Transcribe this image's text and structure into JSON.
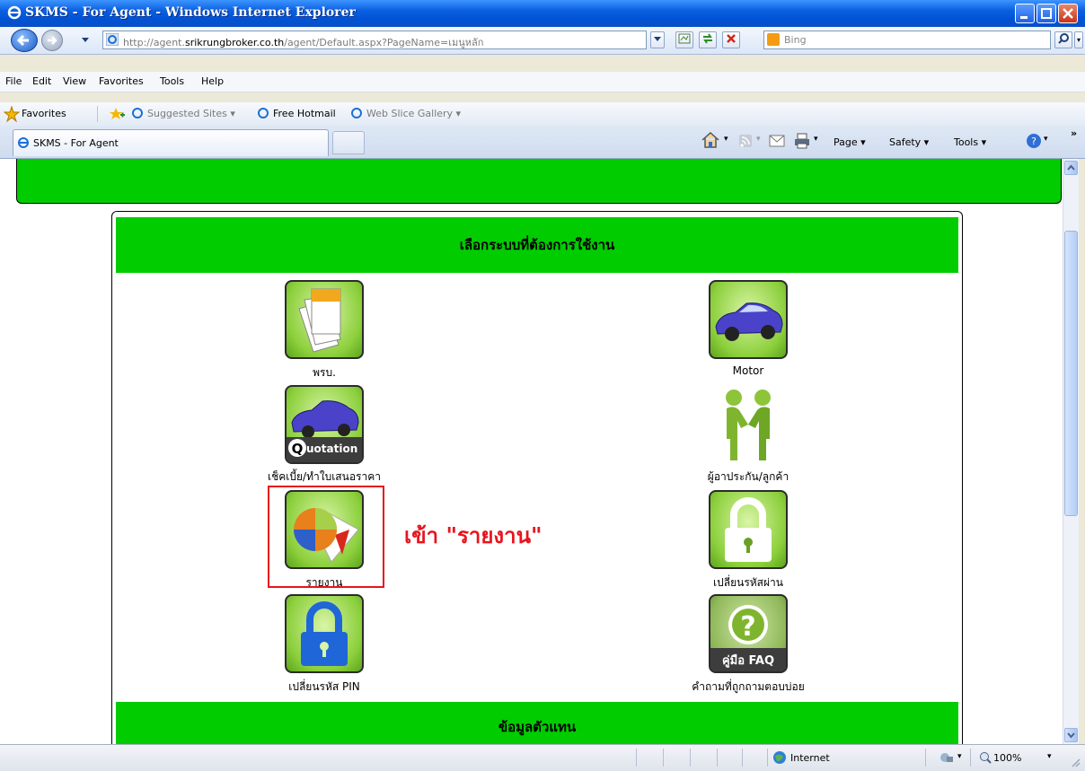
{
  "window": {
    "title": "SKMS - For Agent - Windows Internet Explorer"
  },
  "address": {
    "url_prefix": "http://agent.",
    "url_domain": "srikrungbroker.co.th",
    "url_path": "/agent/Default.aspx?PageName=เมนูหลัก",
    "search_placeholder": "Bing"
  },
  "menu": [
    "File",
    "Edit",
    "View",
    "Favorites",
    "Tools",
    "Help"
  ],
  "favorites": {
    "label": "Favorites",
    "items": [
      "Suggested Sites ▾",
      "Free Hotmail",
      "Web Slice Gallery ▾"
    ]
  },
  "tab": {
    "title": "SKMS - For Agent"
  },
  "commands": {
    "page": "Page ▾",
    "safety": "Safety ▾",
    "tools": "Tools ▾"
  },
  "main": {
    "header": "เลือกระบบที่ต้องการใช้งาน",
    "footer_header": "ข้อมูลตัวแทน",
    "annotation": "เข้า \"รายงาน\"",
    "menu_items": [
      {
        "label": "พรบ.",
        "icon": "documents-icon"
      },
      {
        "label": "Motor",
        "icon": "car-icon"
      },
      {
        "label": "เช็คเบี้ย/ทำใบเสนอราคา",
        "icon": "quotation-icon",
        "badge": "Quotation"
      },
      {
        "label": "ผู้อาประกัน/ลูกค้า",
        "icon": "handshake-icon"
      },
      {
        "label": "รายงาน",
        "icon": "report-chart-icon"
      },
      {
        "label": "เปลี่ยนรหัสผ่าน",
        "icon": "padlock-icon"
      },
      {
        "label": "เปลี่ยนรหัส PIN",
        "icon": "blue-padlock-icon"
      },
      {
        "label": "คำถามที่ถูกถามตอบบ่อย",
        "icon": "faq-question-icon",
        "badge": "คู่มือ FAQ"
      }
    ]
  },
  "status": {
    "zone": "Internet",
    "zoom": "100%"
  }
}
